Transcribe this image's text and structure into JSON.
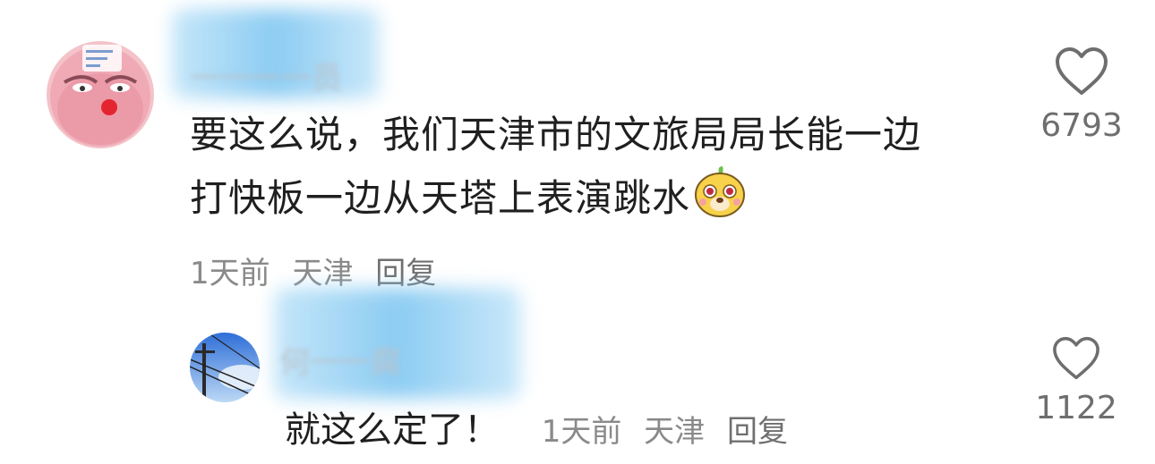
{
  "comment": {
    "username": "一一一一员",
    "text_line1": "要这么说，我们天津市的文旅局局长能一边",
    "text_line2": "打快板一边从天塔上表演跳水",
    "emoji": "doge-emoji",
    "time": "1天前",
    "location": "天津",
    "reply_label": "回复",
    "likes": "6793"
  },
  "reply": {
    "username": "何一一腐",
    "text": "就这么定了！",
    "time": "1天前",
    "location": "天津",
    "reply_label": "回复",
    "likes": "1122"
  },
  "icons": {
    "like": "heart-outline-icon"
  },
  "colors": {
    "text": "#1f1f1f",
    "meta": "#8a8a8a",
    "blur": "#9fd6f3"
  }
}
